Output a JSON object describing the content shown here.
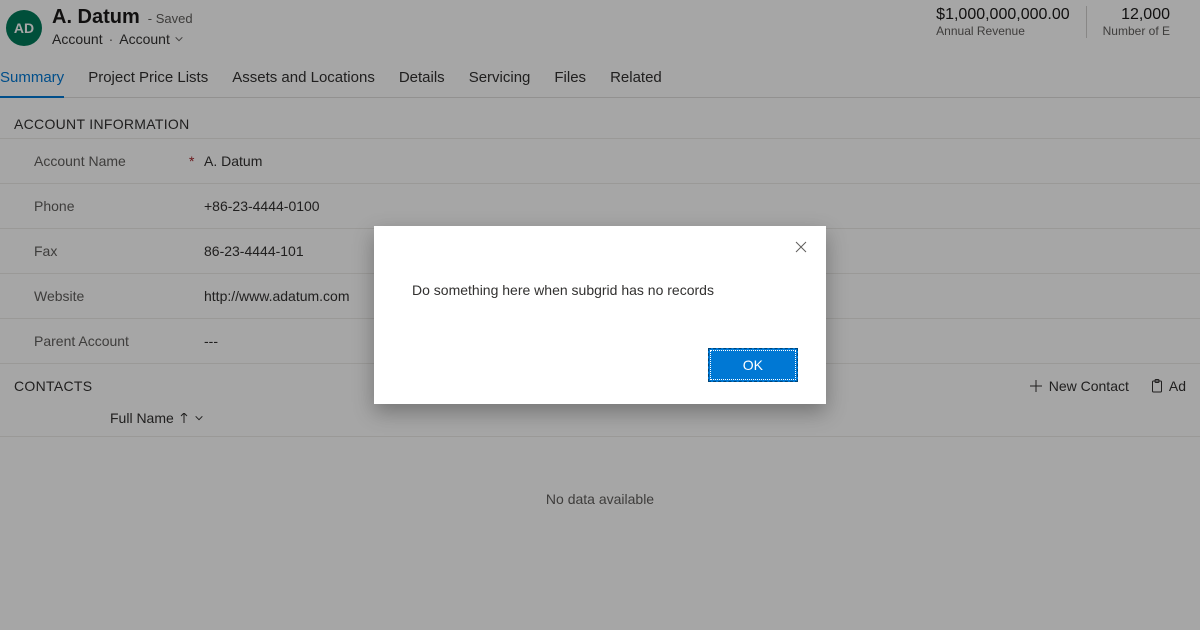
{
  "header": {
    "avatar_initials": "AD",
    "title": "A. Datum",
    "status": "- Saved",
    "entity_label": "Account",
    "form_label": "Account"
  },
  "stats": [
    {
      "value": "$1,000,000,000.00",
      "label": "Annual Revenue"
    },
    {
      "value": "12,000",
      "label": "Number of E"
    }
  ],
  "tabs": [
    "Summary",
    "Project Price Lists",
    "Assets and Locations",
    "Details",
    "Servicing",
    "Files",
    "Related"
  ],
  "active_tab": "Summary",
  "section_title": "ACCOUNT INFORMATION",
  "fields": [
    {
      "label": "Account Name",
      "value": "A. Datum",
      "required": true
    },
    {
      "label": "Phone",
      "value": "+86-23-4444-0100",
      "required": false
    },
    {
      "label": "Fax",
      "value": "86-23-4444-101",
      "required": false
    },
    {
      "label": "Website",
      "value": "http://www.adatum.com",
      "required": false
    },
    {
      "label": "Parent Account",
      "value": "---",
      "required": false
    }
  ],
  "contacts": {
    "title": "CONTACTS",
    "actions": {
      "new": "New Contact",
      "add": "Ad"
    },
    "column": "Full Name",
    "empty_text": "No data available"
  },
  "dialog": {
    "message": "Do something here when subgrid has no records",
    "ok_label": "OK"
  }
}
